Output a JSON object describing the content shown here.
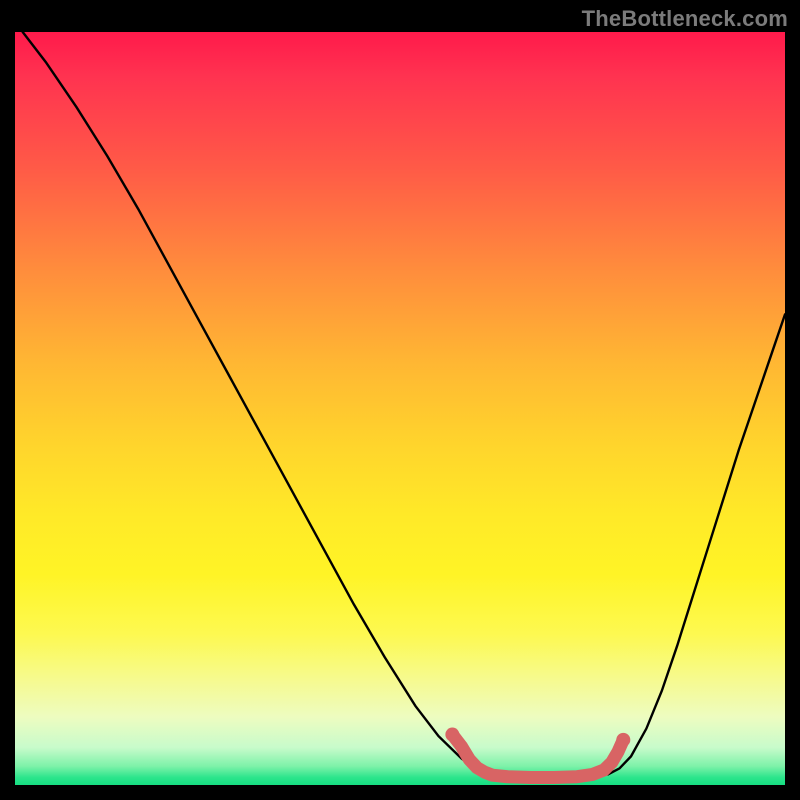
{
  "watermark": "TheBottleneck.com",
  "colors": {
    "background": "#000000",
    "curve_stroke": "#000000",
    "highlight_stroke": "#d86464",
    "gradient_top": "#ff1a4b",
    "gradient_mid": "#ffe928",
    "gradient_bottom": "#16de82"
  },
  "chart_data": {
    "type": "line",
    "title": "",
    "xlabel": "",
    "ylabel": "",
    "xlim": [
      0,
      100
    ],
    "ylim": [
      0,
      100
    ],
    "grid": false,
    "series": [
      {
        "name": "left-curve",
        "x": [
          1,
          4,
          8,
          12,
          16,
          20,
          24,
          28,
          32,
          36,
          40,
          44,
          48,
          52,
          55,
          58,
          60,
          61.5
        ],
        "y": [
          100,
          96,
          90,
          83.5,
          76.5,
          69,
          61.5,
          54,
          46.5,
          39,
          31.5,
          24,
          17,
          10.5,
          6.5,
          3.5,
          2,
          1.4
        ]
      },
      {
        "name": "right-curve",
        "x": [
          77,
          78.5,
          80,
          82,
          84,
          86,
          88,
          90,
          92,
          94,
          96,
          98,
          100
        ],
        "y": [
          1.4,
          2.2,
          3.8,
          7.5,
          12.5,
          18.5,
          25,
          31.5,
          38,
          44.5,
          50.5,
          56.5,
          62.5
        ]
      },
      {
        "name": "minimum-highlight",
        "x": [
          56.8,
          58,
          59,
          60,
          61,
          62,
          64,
          67,
          70,
          73,
          75,
          76.5,
          77.5,
          78.3,
          79
        ],
        "y": [
          6.7,
          5.1,
          3.4,
          2.3,
          1.7,
          1.3,
          1.1,
          1.0,
          1.0,
          1.1,
          1.4,
          2.0,
          3.0,
          4.4,
          6.0
        ]
      }
    ],
    "annotations": []
  }
}
